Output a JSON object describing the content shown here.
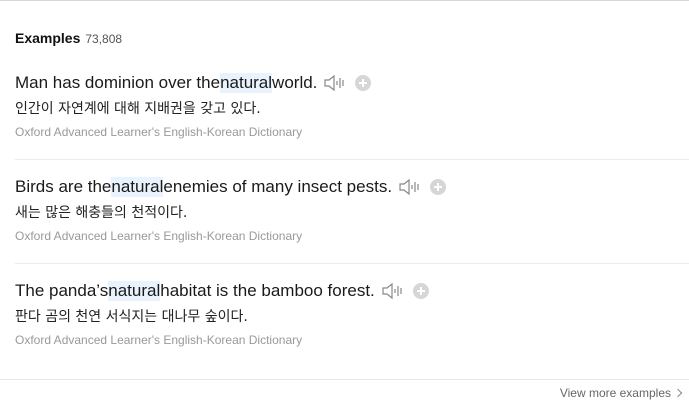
{
  "header": {
    "title": "Examples",
    "count": "73,808"
  },
  "examples": [
    {
      "before": "Man has dominion over the ",
      "keyword": "natural",
      "after": " world.",
      "translation": "인간이 자연계에 대해 지배권을 갖고 있다.",
      "source": "Oxford Advanced Learner's English-Korean Dictionary"
    },
    {
      "before": "Birds are the ",
      "keyword": "natural",
      "after": " enemies of many insect pests.",
      "translation": "새는 많은 해충들의 천적이다.",
      "source": "Oxford Advanced Learner's English-Korean Dictionary"
    },
    {
      "before": "The panda’s ",
      "keyword": "natural",
      "after": " habitat is the bamboo forest.",
      "translation": "판다 곰의 천연 서식지는 대나무 숲이다.",
      "source": "Oxford Advanced Learner's English-Korean Dictionary"
    }
  ],
  "footer": {
    "more_label": "View more examples"
  },
  "icons": {
    "speaker": "speaker-icon",
    "add": "plus-circle-icon",
    "chevron": "chevron-right-icon"
  },
  "colors": {
    "highlight": "#e9f3fd",
    "muted": "#999999"
  }
}
